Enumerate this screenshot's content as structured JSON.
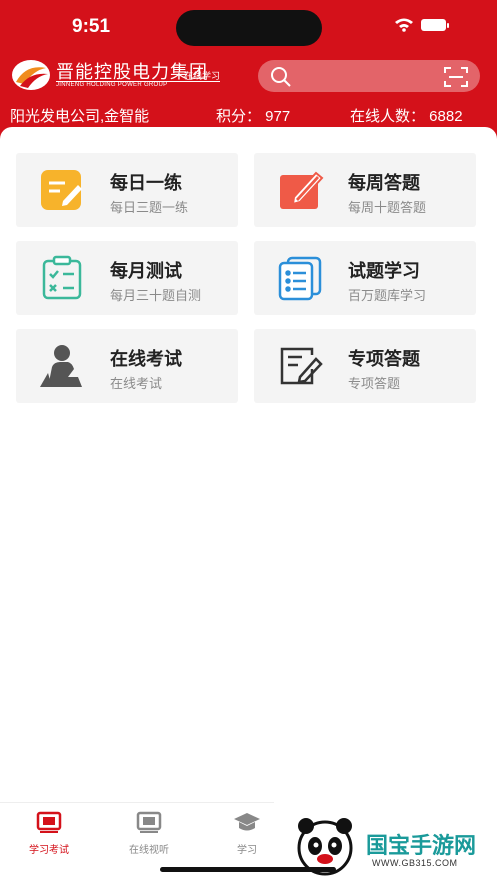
{
  "status": {
    "time": "9:51"
  },
  "header": {
    "logo_cn": "晋能控股电力集团",
    "logo_en": "JINNENG HOLDING POWER GROUP",
    "logo_tag": "在线学习"
  },
  "info": {
    "company": "阳光发电公司,金智能",
    "points": "积分： 977",
    "online": "在线人数： 6882"
  },
  "cards": [
    {
      "title": "每日一练",
      "sub": "每日三题一练",
      "icon": "pencil-note-icon",
      "color": "#f7b32b"
    },
    {
      "title": "每周答题",
      "sub": "每周十题答题",
      "icon": "pen-paper-icon",
      "color": "#ef5a47"
    },
    {
      "title": "每月测试",
      "sub": "每月三十题自测",
      "icon": "clipboard-check-icon",
      "color": "#3bb89a"
    },
    {
      "title": "试题学习",
      "sub": "百万题库学习",
      "icon": "document-list-icon",
      "color": "#2b8fd9"
    },
    {
      "title": "在线考试",
      "sub": "在线考试",
      "icon": "person-desk-icon",
      "color": "#555555"
    },
    {
      "title": "专项答题",
      "sub": "专项答题",
      "icon": "edit-form-icon",
      "color": "#333333"
    }
  ],
  "tabs": [
    {
      "label": "学习考试",
      "icon": "exam-icon",
      "active": true
    },
    {
      "label": "在线视听",
      "icon": "video-icon",
      "active": false
    },
    {
      "label": "学习",
      "icon": "graduation-cap-icon",
      "active": false
    }
  ],
  "watermark": {
    "name": "国宝手游网",
    "url": "WWW.GB315.COM"
  },
  "colors": {
    "brand": "#d4111a"
  }
}
